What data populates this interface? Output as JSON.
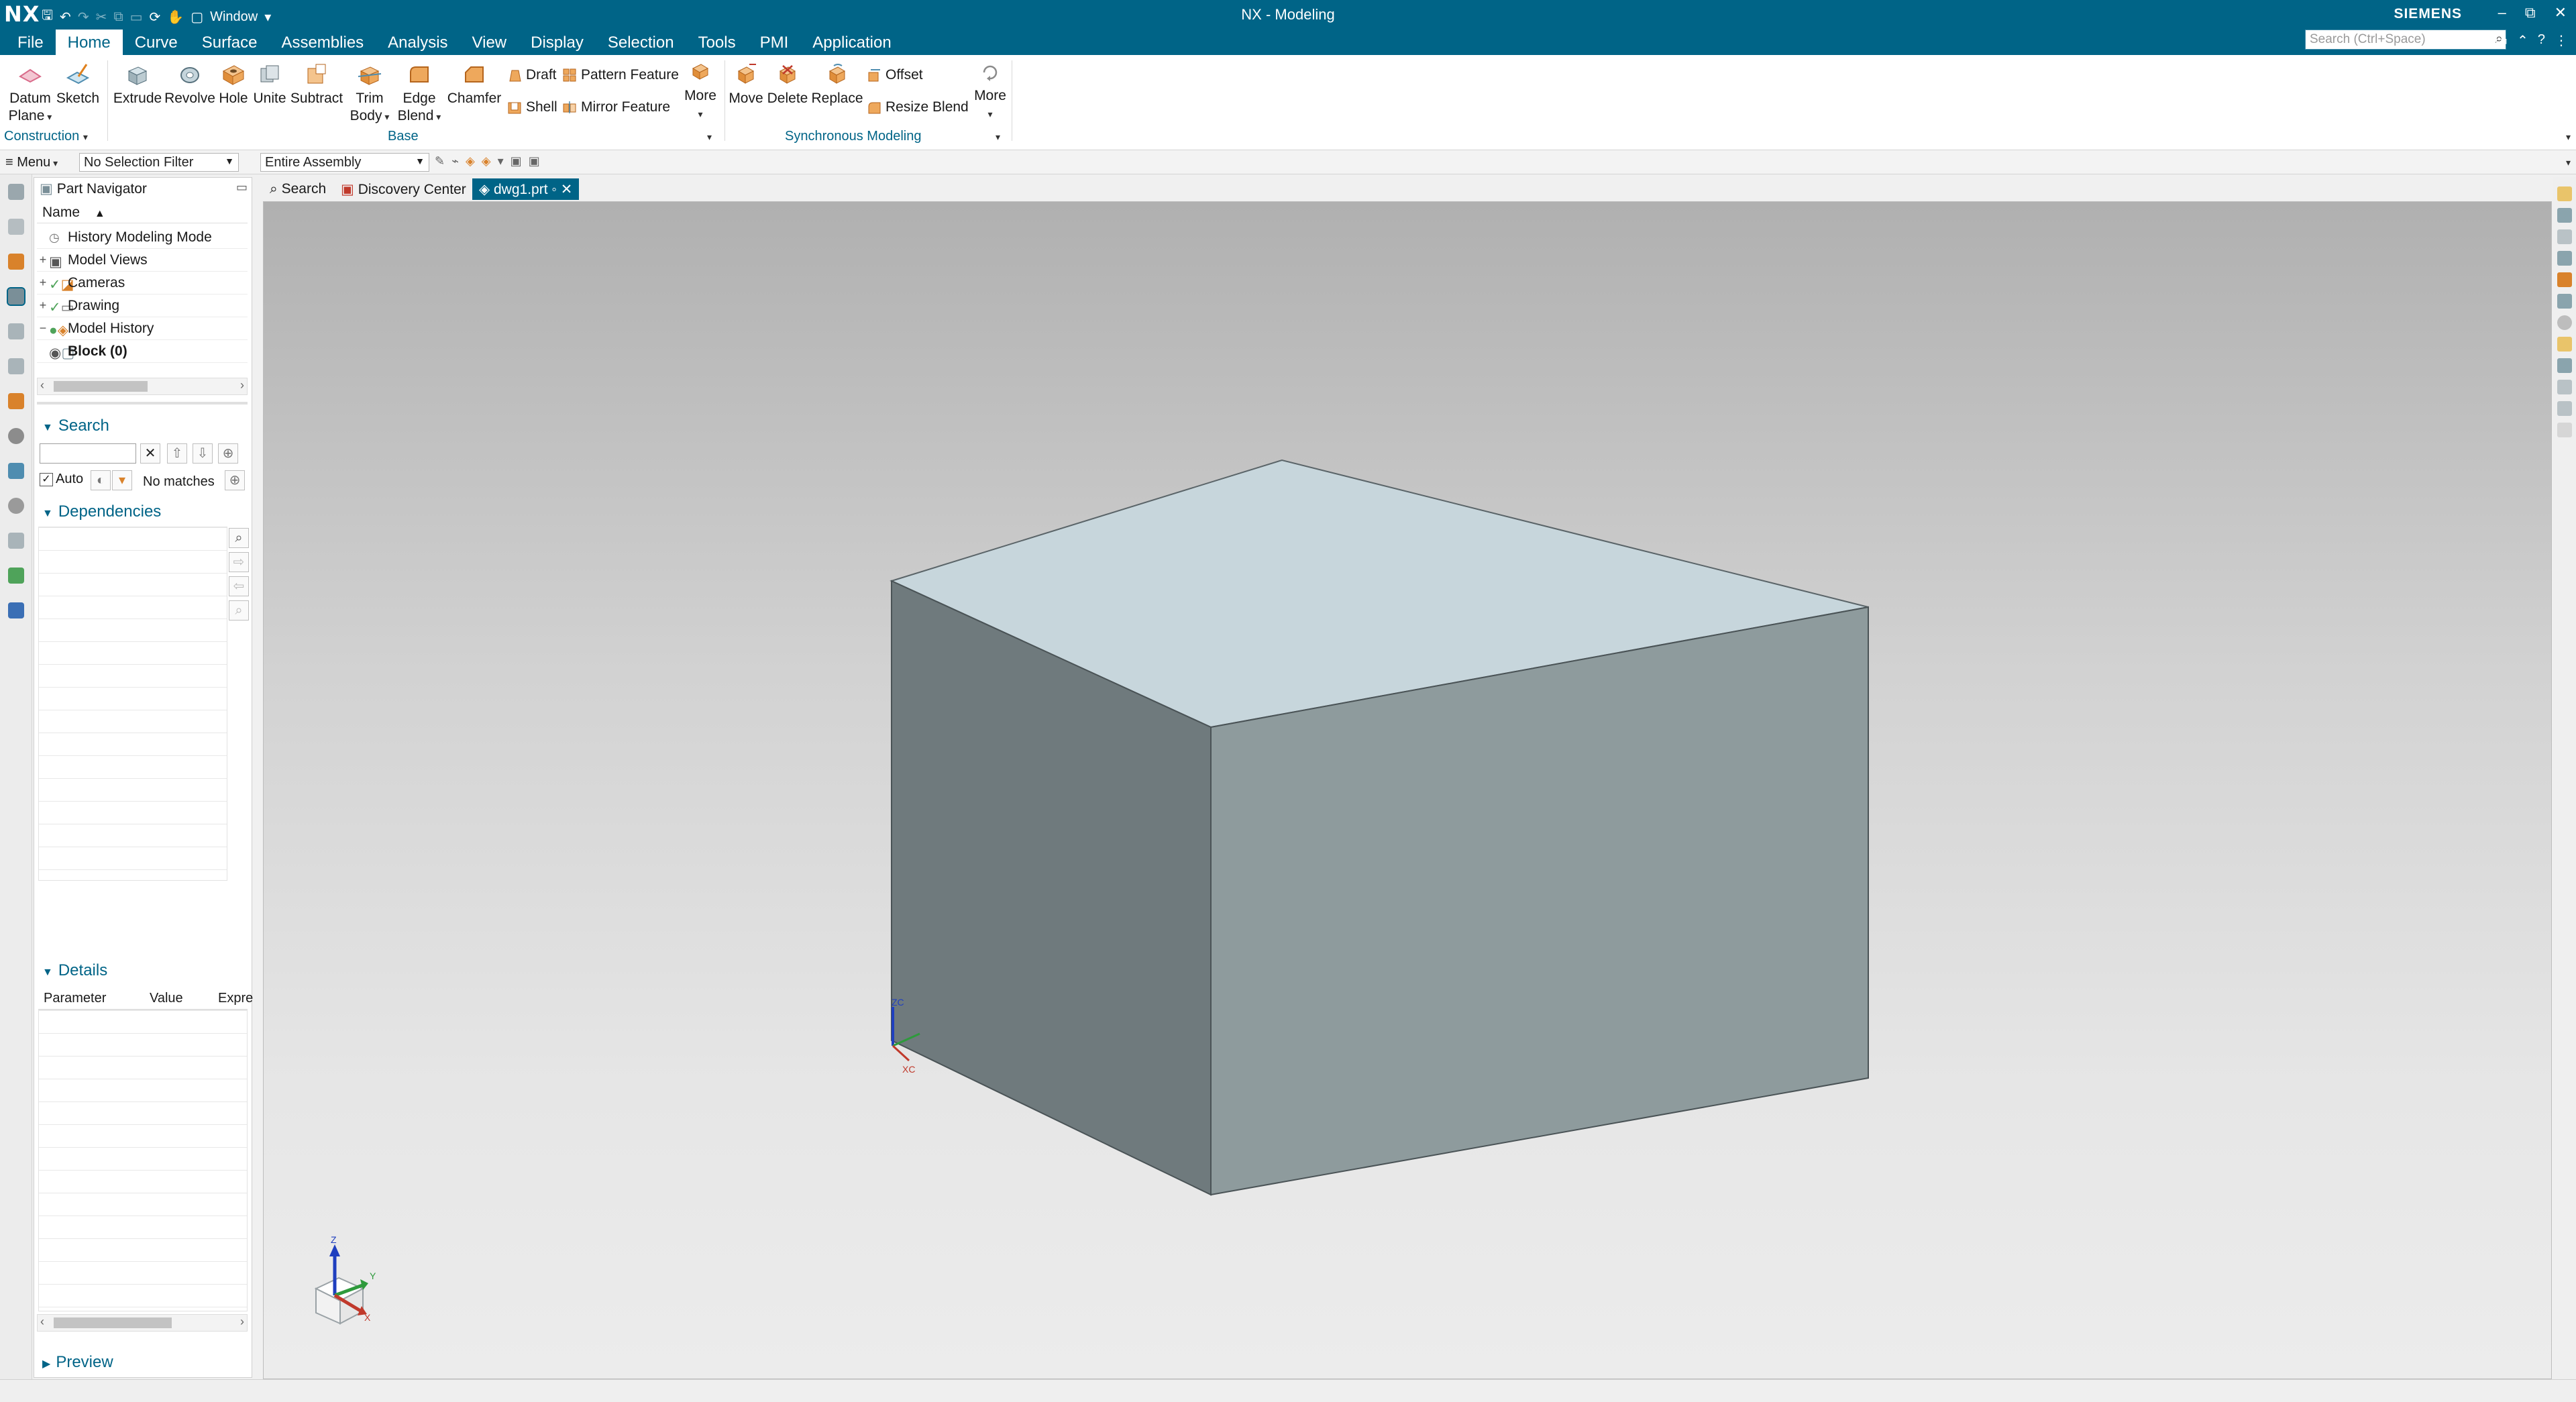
{
  "titlebar": {
    "logo": "NX",
    "window_menu": "Window",
    "title": "NX - Modeling",
    "brand": "SIEMENS",
    "minimize": "–",
    "restore": "⧉",
    "close": "✕"
  },
  "menubar": {
    "tabs": [
      "File",
      "Home",
      "Curve",
      "Surface",
      "Assemblies",
      "Analysis",
      "View",
      "Display",
      "Selection",
      "Tools",
      "PMI",
      "Application"
    ],
    "active_tab": "Home",
    "search_placeholder": "Search (Ctrl+Space)"
  },
  "ribbon": {
    "datum_plane": "Datum\nPlane",
    "datum_plane_l1": "Datum",
    "datum_plane_l2": "Plane",
    "sketch": "Sketch",
    "extrude": "Extrude",
    "revolve": "Revolve",
    "hole": "Hole",
    "unite": "Unite",
    "subtract": "Subtract",
    "trim_body_l1": "Trim",
    "trim_body_l2": "Body",
    "edge_blend_l1": "Edge",
    "edge_blend_l2": "Blend",
    "chamfer": "Chamfer",
    "draft": "Draft",
    "pattern_feature": "Pattern Feature",
    "shell": "Shell",
    "mirror_feature": "Mirror Feature",
    "more": "More",
    "move": "Move",
    "delete": "Delete",
    "replace": "Replace",
    "offset": "Offset",
    "resize_blend": "Resize Blend",
    "more2": "More",
    "group_construction": "Construction",
    "group_base": "Base",
    "group_sync": "Synchronous Modeling"
  },
  "selbar": {
    "menu": "Menu",
    "selection_filter": "No Selection Filter",
    "scope": "Entire Assembly"
  },
  "navigator": {
    "title": "Part Navigator",
    "column_name": "Name",
    "rows": [
      {
        "label": "History Modeling Mode",
        "bold": false
      },
      {
        "label": "Model Views",
        "bold": false
      },
      {
        "label": "Cameras",
        "bold": false
      },
      {
        "label": "Drawing",
        "bold": false
      },
      {
        "label": "Model History",
        "bold": false
      },
      {
        "label": "Block (0)",
        "bold": true
      }
    ],
    "search_title": "Search",
    "auto_label": "Auto",
    "no_matches": "No matches",
    "dependencies_title": "Dependencies",
    "details_title": "Details",
    "details_columns": [
      "Parameter",
      "Value",
      "Expre"
    ],
    "preview_title": "Preview"
  },
  "doctabs": {
    "search": "Search",
    "discovery": "Discovery Center",
    "file": "dwg1.prt"
  },
  "viewport": {
    "wcs_z": "ZC",
    "wcs_x": "XC",
    "triad_z": "Z",
    "triad_y": "Y",
    "triad_x": "X"
  },
  "colors": {
    "accent": "#006487",
    "cube_top": "#c7d6dc",
    "cube_left": "#6f7a7d",
    "cube_right": "#8e9b9d"
  }
}
